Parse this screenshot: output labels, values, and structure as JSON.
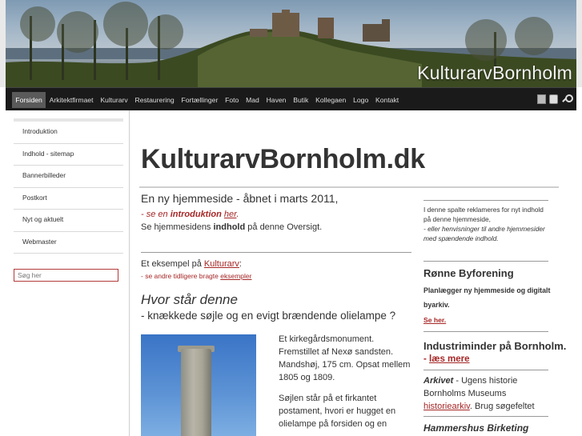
{
  "banner": {
    "brand": "KulturarvBornholm"
  },
  "nav": {
    "items": [
      "Forsiden",
      "Arkitektfirmaet",
      "Kulturarv",
      "Restaurering",
      "Fortællinger",
      "Foto",
      "Mad",
      "Haven",
      "Butik",
      "Kollegaen",
      "Logo",
      "Kontakt"
    ],
    "active": "Forsiden",
    "tools": [
      "pdf-icon",
      "print-icon",
      "key-icon"
    ]
  },
  "sidebar": {
    "items": [
      "Introduktion",
      "Indhold - sitemap",
      "Bannerbilleder",
      "Postkort",
      "Nyt og aktuelt",
      "Webmaster"
    ],
    "search_placeholder": "Søg her"
  },
  "main": {
    "title": "KulturarvBornholm.dk",
    "intro_head": "En ny hjemmeside - åbnet i marts 2011,",
    "intro_line2_pre": "- se en ",
    "intro_line2_bold": "introduktion",
    "intro_line2_link": "her",
    "intro_line2_post": ".",
    "intro_line3_pre": "Se hjemmesidens ",
    "intro_line3_bold": "indhold",
    "intro_line3_post": " på denne Oversigt.",
    "example_pre": "Et eksempel på ",
    "example_link": "Kulturarv",
    "example_post": ":",
    "example2_pre": "- se andre tidligere bragte ",
    "example2_link": "eksempler",
    "question_title": "Hvor står denne",
    "question_sub": "- knækkede søjle og en evigt brændende olielampe ?",
    "para1": "Et kirkegårdsmonument. Fremstillet af Nexø sandsten. Mandshøj, 175 cm. Opsat mellem 1805 og 1809.",
    "para2": "Søjlen står på et firkantet postament, hvori er hugget en olielampe på forsiden og en"
  },
  "right": {
    "notice": "I denne spalte reklameres for nyt indhold på denne hjemmeside,",
    "notice_italic": "- eller henvisninger til andre hjemmesider med spændende indhold.",
    "block1_head": "Rønne Byforening",
    "block1_text": "Planlægger ny hjemmeside og digitalt byarkiv.",
    "block1_link": "Se her.",
    "block2_head": "Industriminder på Bornholm.",
    "block2_link_pre": "- ",
    "block2_link": "læs mere",
    "block3_bold": "Arkivet",
    "block3_pre": " - Ugens historie Bornholms Museums ",
    "block3_link": "historiearkiv",
    "block3_post": ". Brug søgefeltet",
    "block4_head": "Hammershus Birketing"
  }
}
